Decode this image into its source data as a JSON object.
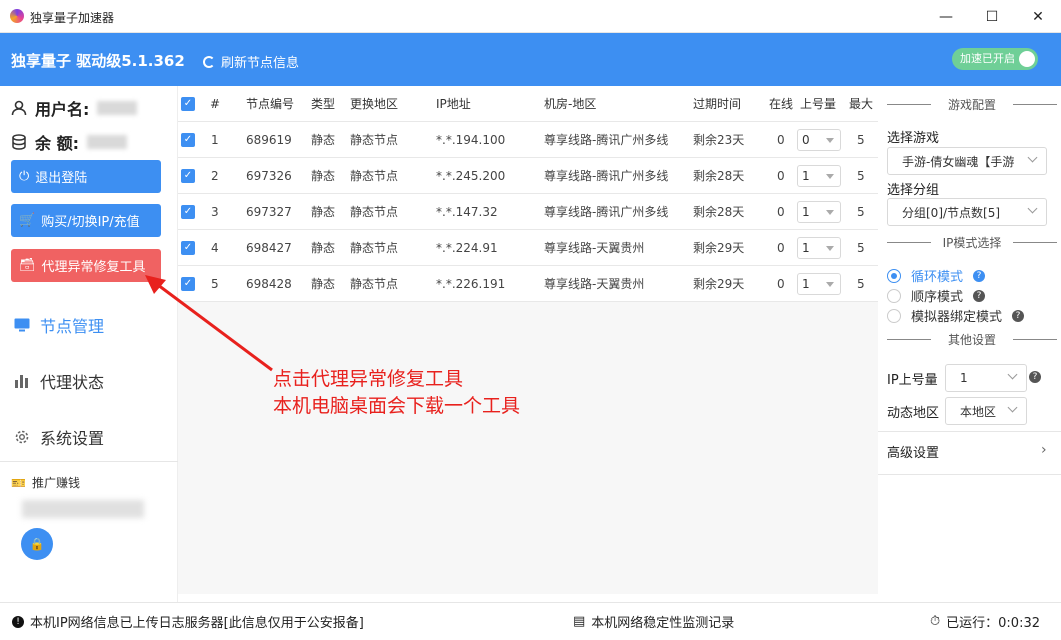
{
  "window": {
    "title": "独享量子加速器",
    "minimize": "—",
    "maximize": "☐",
    "close": "✕"
  },
  "header": {
    "brand": "独享量子 驱动级5.1.362",
    "refresh_label": "刷新节点信息",
    "toggle_label": "加速已开启"
  },
  "sidebar": {
    "username_label": "用户名:",
    "balance_label": "余  额:",
    "buttons": {
      "logout": "退出登陆",
      "buy": "购买/切换IP/充值",
      "repair": "代理异常修复工具"
    },
    "nav": [
      {
        "label": "节点管理",
        "icon": "monitor-icon"
      },
      {
        "label": "代理状态",
        "icon": "bar-chart-icon"
      },
      {
        "label": "系统设置",
        "icon": "gear-icon"
      }
    ],
    "promo_label": "推广赚钱"
  },
  "table": {
    "headers": {
      "check": "",
      "index": "#",
      "node_id": "节点编号",
      "type": "类型",
      "change_region": "更换地区",
      "ip": "IP地址",
      "room": "机房-地区",
      "expire": "过期时间",
      "online": "在线",
      "upload": "上号量",
      "max": "最大"
    },
    "rows": [
      {
        "index": "1",
        "node_id": "689619",
        "type": "静态",
        "change_region": "静态节点",
        "ip": "*.*.194.100",
        "room": "尊享线路-腾讯广州多线",
        "expire": "剩余23天",
        "online": "0",
        "upload": "0",
        "max": "5"
      },
      {
        "index": "2",
        "node_id": "697326",
        "type": "静态",
        "change_region": "静态节点",
        "ip": "*.*.245.200",
        "room": "尊享线路-腾讯广州多线",
        "expire": "剩余28天",
        "online": "0",
        "upload": "1",
        "max": "5"
      },
      {
        "index": "3",
        "node_id": "697327",
        "type": "静态",
        "change_region": "静态节点",
        "ip": "*.*.147.32",
        "room": "尊享线路-腾讯广州多线",
        "expire": "剩余28天",
        "online": "0",
        "upload": "1",
        "max": "5"
      },
      {
        "index": "4",
        "node_id": "698427",
        "type": "静态",
        "change_region": "静态节点",
        "ip": "*.*.224.91",
        "room": "尊享线路-天翼贵州",
        "expire": "剩余29天",
        "online": "0",
        "upload": "1",
        "max": "5"
      },
      {
        "index": "5",
        "node_id": "698428",
        "type": "静态",
        "change_region": "静态节点",
        "ip": "*.*.226.191",
        "room": "尊享线路-天翼贵州",
        "expire": "剩余29天",
        "online": "0",
        "upload": "1",
        "max": "5"
      }
    ]
  },
  "right_panel": {
    "game_config_title": "游戏配置",
    "select_game_label": "选择游戏",
    "select_game_value": "手游-倩女幽魂【手游",
    "select_group_label": "选择分组",
    "select_group_value": "分组[0]/节点数[5]",
    "ip_mode_title": "IP模式选择",
    "modes": [
      "循环模式",
      "顺序模式",
      "模拟器绑定模式"
    ],
    "other_title": "其他设置",
    "ip_upload_label": "IP上号量",
    "ip_upload_value": "1",
    "dynamic_region_label": "动态地区",
    "dynamic_region_value": "本地区",
    "advanced_label": "高级设置"
  },
  "footer": {
    "left": "本机IP网络信息已上传日志服务器[此信息仅用于公安报备]",
    "center": "本机网络稳定性监测记录",
    "right": "已运行：0:0:32"
  },
  "annotation": {
    "line1": "点击代理异常修复工具",
    "line2": "本机电脑桌面会下载一个工具"
  },
  "colors": {
    "accent": "#3d8ff2",
    "danger": "#f06262",
    "annotation": "#e8211d",
    "toggle_on": "#6fcf97"
  }
}
